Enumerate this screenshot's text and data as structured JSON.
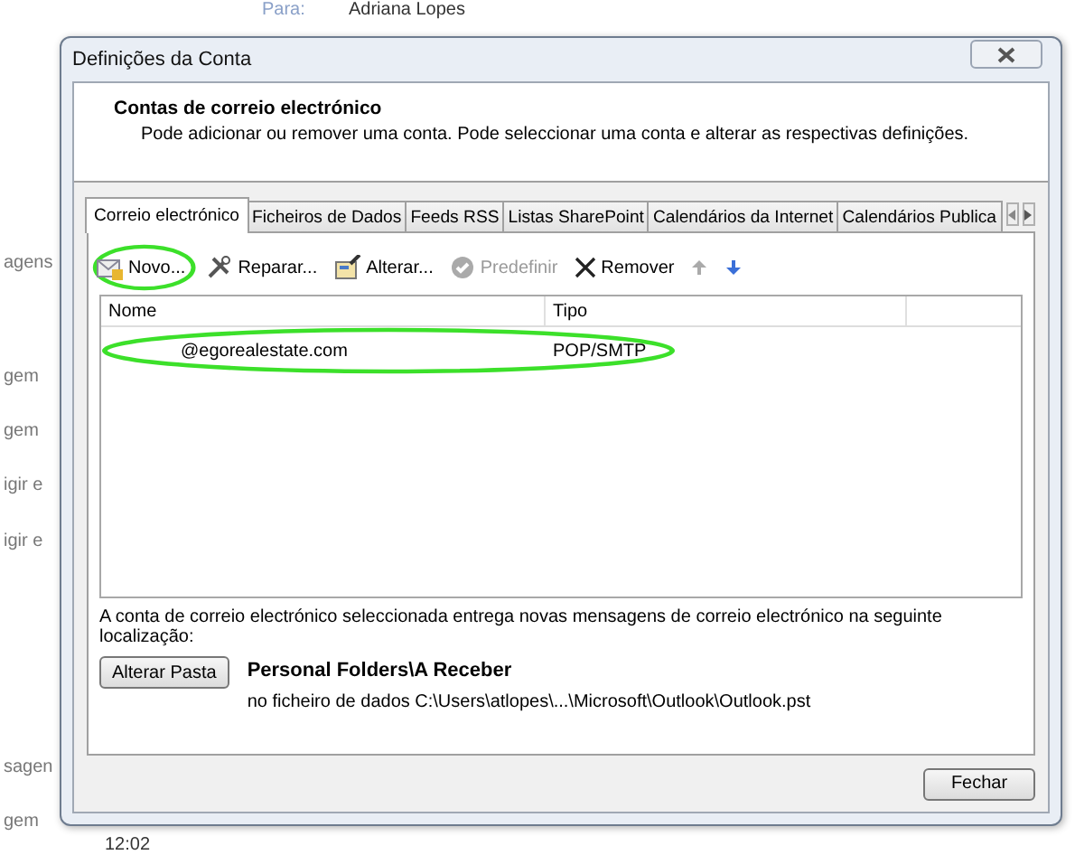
{
  "background": {
    "header_label": "Para:",
    "header_value": "Adriana Lopes",
    "list_items": [
      "agens",
      "gem",
      "gem",
      "igir e",
      "igir e",
      "sagen",
      "gem"
    ],
    "time": "12:02"
  },
  "window": {
    "title": "Definições da Conta"
  },
  "header": {
    "title": "Contas de correio electrónico",
    "description": "Pode adicionar ou remover uma conta. Pode seleccionar uma conta e alterar as respectivas definições."
  },
  "tabs": [
    {
      "label": "Correio electrónico",
      "selected": true
    },
    {
      "label": "Ficheiros de Dados",
      "selected": false
    },
    {
      "label": "Feeds RSS",
      "selected": false
    },
    {
      "label": "Listas SharePoint",
      "selected": false
    },
    {
      "label": "Calendários da Internet",
      "selected": false
    },
    {
      "label": "Calendários Publica",
      "selected": false
    }
  ],
  "toolbar": [
    {
      "kind": "new",
      "label": "Novo...",
      "disabled": false,
      "highlighted": true
    },
    {
      "kind": "repair",
      "label": "Reparar...",
      "disabled": false,
      "highlighted": false
    },
    {
      "kind": "change",
      "label": "Alterar...",
      "disabled": false,
      "highlighted": false
    },
    {
      "kind": "default",
      "label": "Predefinir",
      "disabled": true,
      "highlighted": false
    },
    {
      "kind": "remove",
      "label": "Remover",
      "disabled": false,
      "highlighted": false
    },
    {
      "kind": "up",
      "disabled": true,
      "highlighted": false
    },
    {
      "kind": "down",
      "disabled": false,
      "highlighted": false
    }
  ],
  "table": {
    "columns": [
      "Nome",
      "Tipo"
    ],
    "rows": [
      {
        "name": "@egorealestate.com",
        "type": "POP/SMTP",
        "highlighted": true
      }
    ]
  },
  "delivery": {
    "text": "A conta de correio electrónico seleccionada entrega novas mensagens de correio electrónico na seguinte localização:",
    "button": "Alterar Pasta",
    "folder": "Personal Folders\\A Receber",
    "path": "no ficheiro de dados C:\\Users\\atlopes\\...\\Microsoft\\Outlook\\Outlook.pst"
  },
  "buttons": [
    "Fechar"
  ]
}
